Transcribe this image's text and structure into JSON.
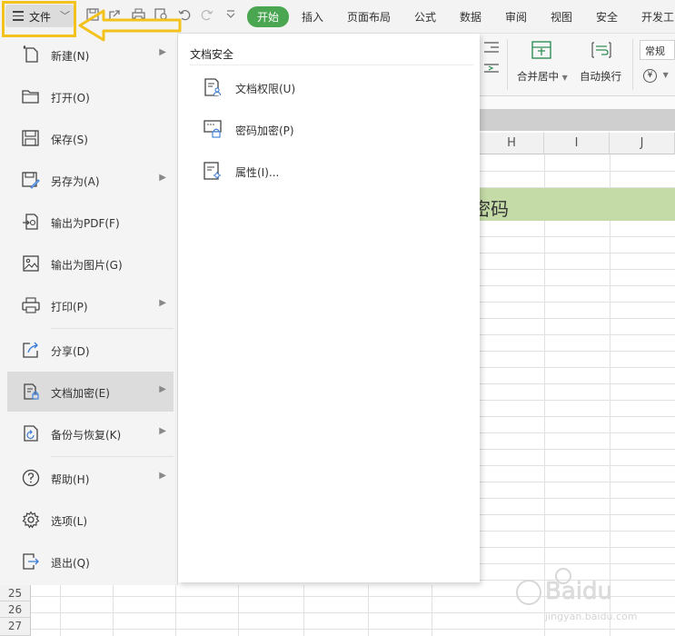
{
  "toolbar": {
    "file_label": "文件",
    "tabs": [
      "开始",
      "插入",
      "页面布局",
      "公式",
      "数据",
      "审阅",
      "视图",
      "安全",
      "开发工"
    ],
    "active_tab": "开始"
  },
  "ribbon": {
    "merge_label": "合并居中",
    "wrap_label": "自动换行",
    "format_value": "常规",
    "currency_symbol": "¥"
  },
  "sheet": {
    "columns": [
      "H",
      "I",
      "J"
    ],
    "highlight_text": "密码",
    "rows": [
      "25",
      "26",
      "27"
    ]
  },
  "file_menu": {
    "items": [
      {
        "label": "新建(N)",
        "icon": "new-file-icon",
        "has_arrow": true
      },
      {
        "label": "打开(O)",
        "icon": "folder-open-icon",
        "has_arrow": false
      },
      {
        "label": "保存(S)",
        "icon": "save-icon",
        "has_arrow": false
      },
      {
        "label": "另存为(A)",
        "icon": "save-as-icon",
        "has_arrow": true
      },
      {
        "label": "输出为PDF(F)",
        "icon": "pdf-export-icon",
        "has_arrow": false
      },
      {
        "label": "输出为图片(G)",
        "icon": "image-export-icon",
        "has_arrow": false
      },
      {
        "label": "打印(P)",
        "icon": "printer-icon",
        "has_arrow": true
      },
      {
        "label": "分享(D)",
        "icon": "share-icon",
        "has_arrow": false
      },
      {
        "label": "文档加密(E)",
        "icon": "document-lock-icon",
        "has_arrow": true,
        "selected": true
      },
      {
        "label": "备份与恢复(K)",
        "icon": "backup-icon",
        "has_arrow": true
      },
      {
        "label": "帮助(H)",
        "icon": "help-icon",
        "has_arrow": true
      },
      {
        "label": "选项(L)",
        "icon": "gear-icon",
        "has_arrow": false
      },
      {
        "label": "退出(Q)",
        "icon": "exit-icon",
        "has_arrow": false
      }
    ]
  },
  "submenu": {
    "title": "文档安全",
    "items": [
      {
        "label": "文档权限(U)",
        "icon": "document-permission-icon"
      },
      {
        "label": "密码加密(P)",
        "icon": "password-lock-icon"
      },
      {
        "label": "属性(I)...",
        "icon": "properties-icon"
      }
    ]
  },
  "colors": {
    "accent_green": "#4aa651",
    "highlight_yellow": "#f3c21c",
    "row_highlight": "#c5dba7"
  }
}
